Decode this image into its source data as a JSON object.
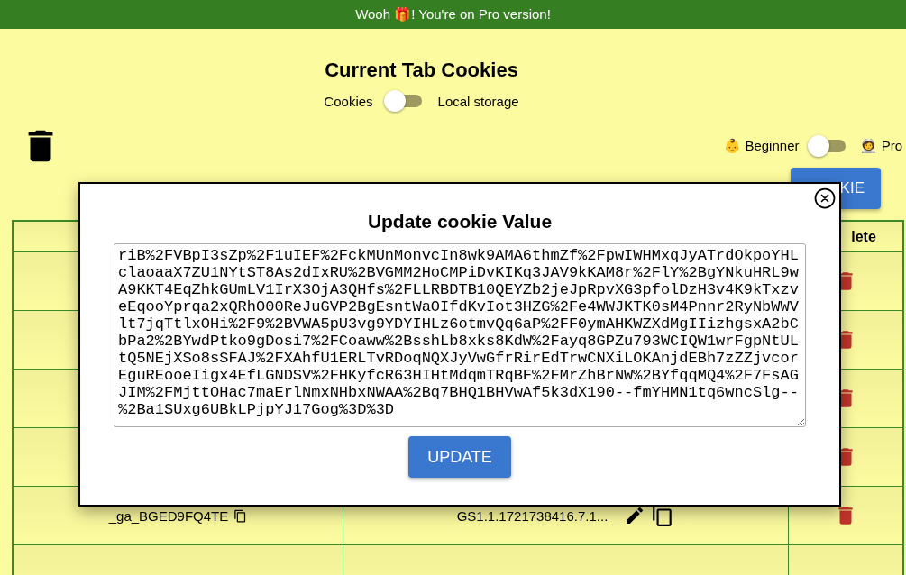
{
  "banner": {
    "text": "Wooh 🎁! You're on Pro version!"
  },
  "title": "Current Tab Cookies",
  "storage_toggle": {
    "left_label": "Cookies",
    "right_label": "Local storage",
    "on": false
  },
  "mode_toggle": {
    "left_label": "👶 Beginner",
    "right_label": "🧑‍🚀 Pro",
    "on": false
  },
  "add_button": {
    "label": "KIE"
  },
  "table": {
    "column_3": "lete",
    "rows": [
      {
        "kind": "covered"
      },
      {
        "kind": "covered"
      },
      {
        "kind": "covered"
      },
      {
        "kind": "covered"
      },
      {
        "kind": "cookie",
        "name": "_ga_BGED9FQ4TE",
        "value": "GS1.1.1721738416.7.1..."
      },
      {
        "kind": "cut"
      }
    ]
  },
  "dialog": {
    "title": "Update cookie Value",
    "value": "riB%2FVBpI3sZp%2F1uIEF%2FckMUnMonvcIn8wk9AMA6thmZf%2FpwIWHMxqJyATrdOkpoYHLclaoaaX7ZU1NYtST8As2dIxRU%2BVGMM2HoCMPiDvKIKq3JAV9kKAM8r%2FlY%2BgYNkuHRL9wA9KKT4EqZhkGUmLV1IrX3OjA3QHfs%2FLLRBDTB10QEYZb2jeJpRpvXG3pfolDzH3v4K9kTxzveEqooYprqa2xQRhO00ReJuGVP2BgEsntWaOIfdKvIot3HZG%2Fe4WWJKTK0sM4Pnnr2RyNbWWVlt7jqTtlxOHi%2F9%2BVWA5pU3vg9YDYIHLz6otmvQq6aP%2FF0ymAHKWZXdMgIIizhgsxA2bCbPa2%2BYwdPtko9gDosi7%2FCoaww%2BsshLb8xks8KdW%2Fayq8GPZu793WCIQW1wrFgpNtULtQ5NEjXSo8sSFAJ%2FXAhfU1ERLTvRDoqNQXJyVwGfrRirEdTrwCNXiLOKAnjdEBh7zZZjvcorEguREooeIigx4EfLGNDSV%2FHKyfcR63HIHtMdqmTRqBF%2FMrZhBrNW%2BYfqqMQ4%2F7FsAGJIM%2FMjttOHac7maErlNmxNHbxNWAA%2Bq7BHQ1BHVwAf5k3dX190--fmYHMN1tq6wncSlg--%2Ba1SUxg6UBkLPjpYJ17Gog%3D%3D",
    "button": "UPDATE"
  }
}
